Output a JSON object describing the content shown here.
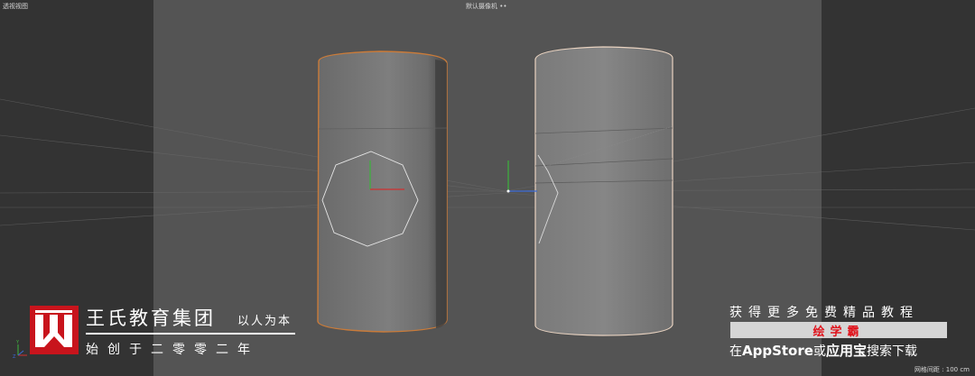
{
  "viewport": {
    "view_name": "透视视图",
    "camera_name": "默认摄像机 ••",
    "grid_scale": "网格间距 : 100 cm"
  },
  "overlay": {
    "company_name": "王氏教育集团",
    "motto": "以人为本",
    "founded": "始创于二零零二年",
    "promo_line1": "获得更多免费精品教程",
    "promo_brand": "绘学霸",
    "promo_prefix": "在",
    "promo_appstore": "AppStore",
    "promo_or": "或",
    "promo_yyb": "应用宝",
    "promo_suffix": "搜索下载"
  },
  "colors": {
    "selection_outline": "#c97b3a",
    "logo_red": "#c8141c",
    "brand_red": "#e0121b",
    "axis_x": "#d03030",
    "axis_y": "#3cb43c",
    "axis_z": "#3a6ad8"
  },
  "icons": {
    "axis": "world-axis-icon",
    "logo": "wangshi-w-logo"
  }
}
